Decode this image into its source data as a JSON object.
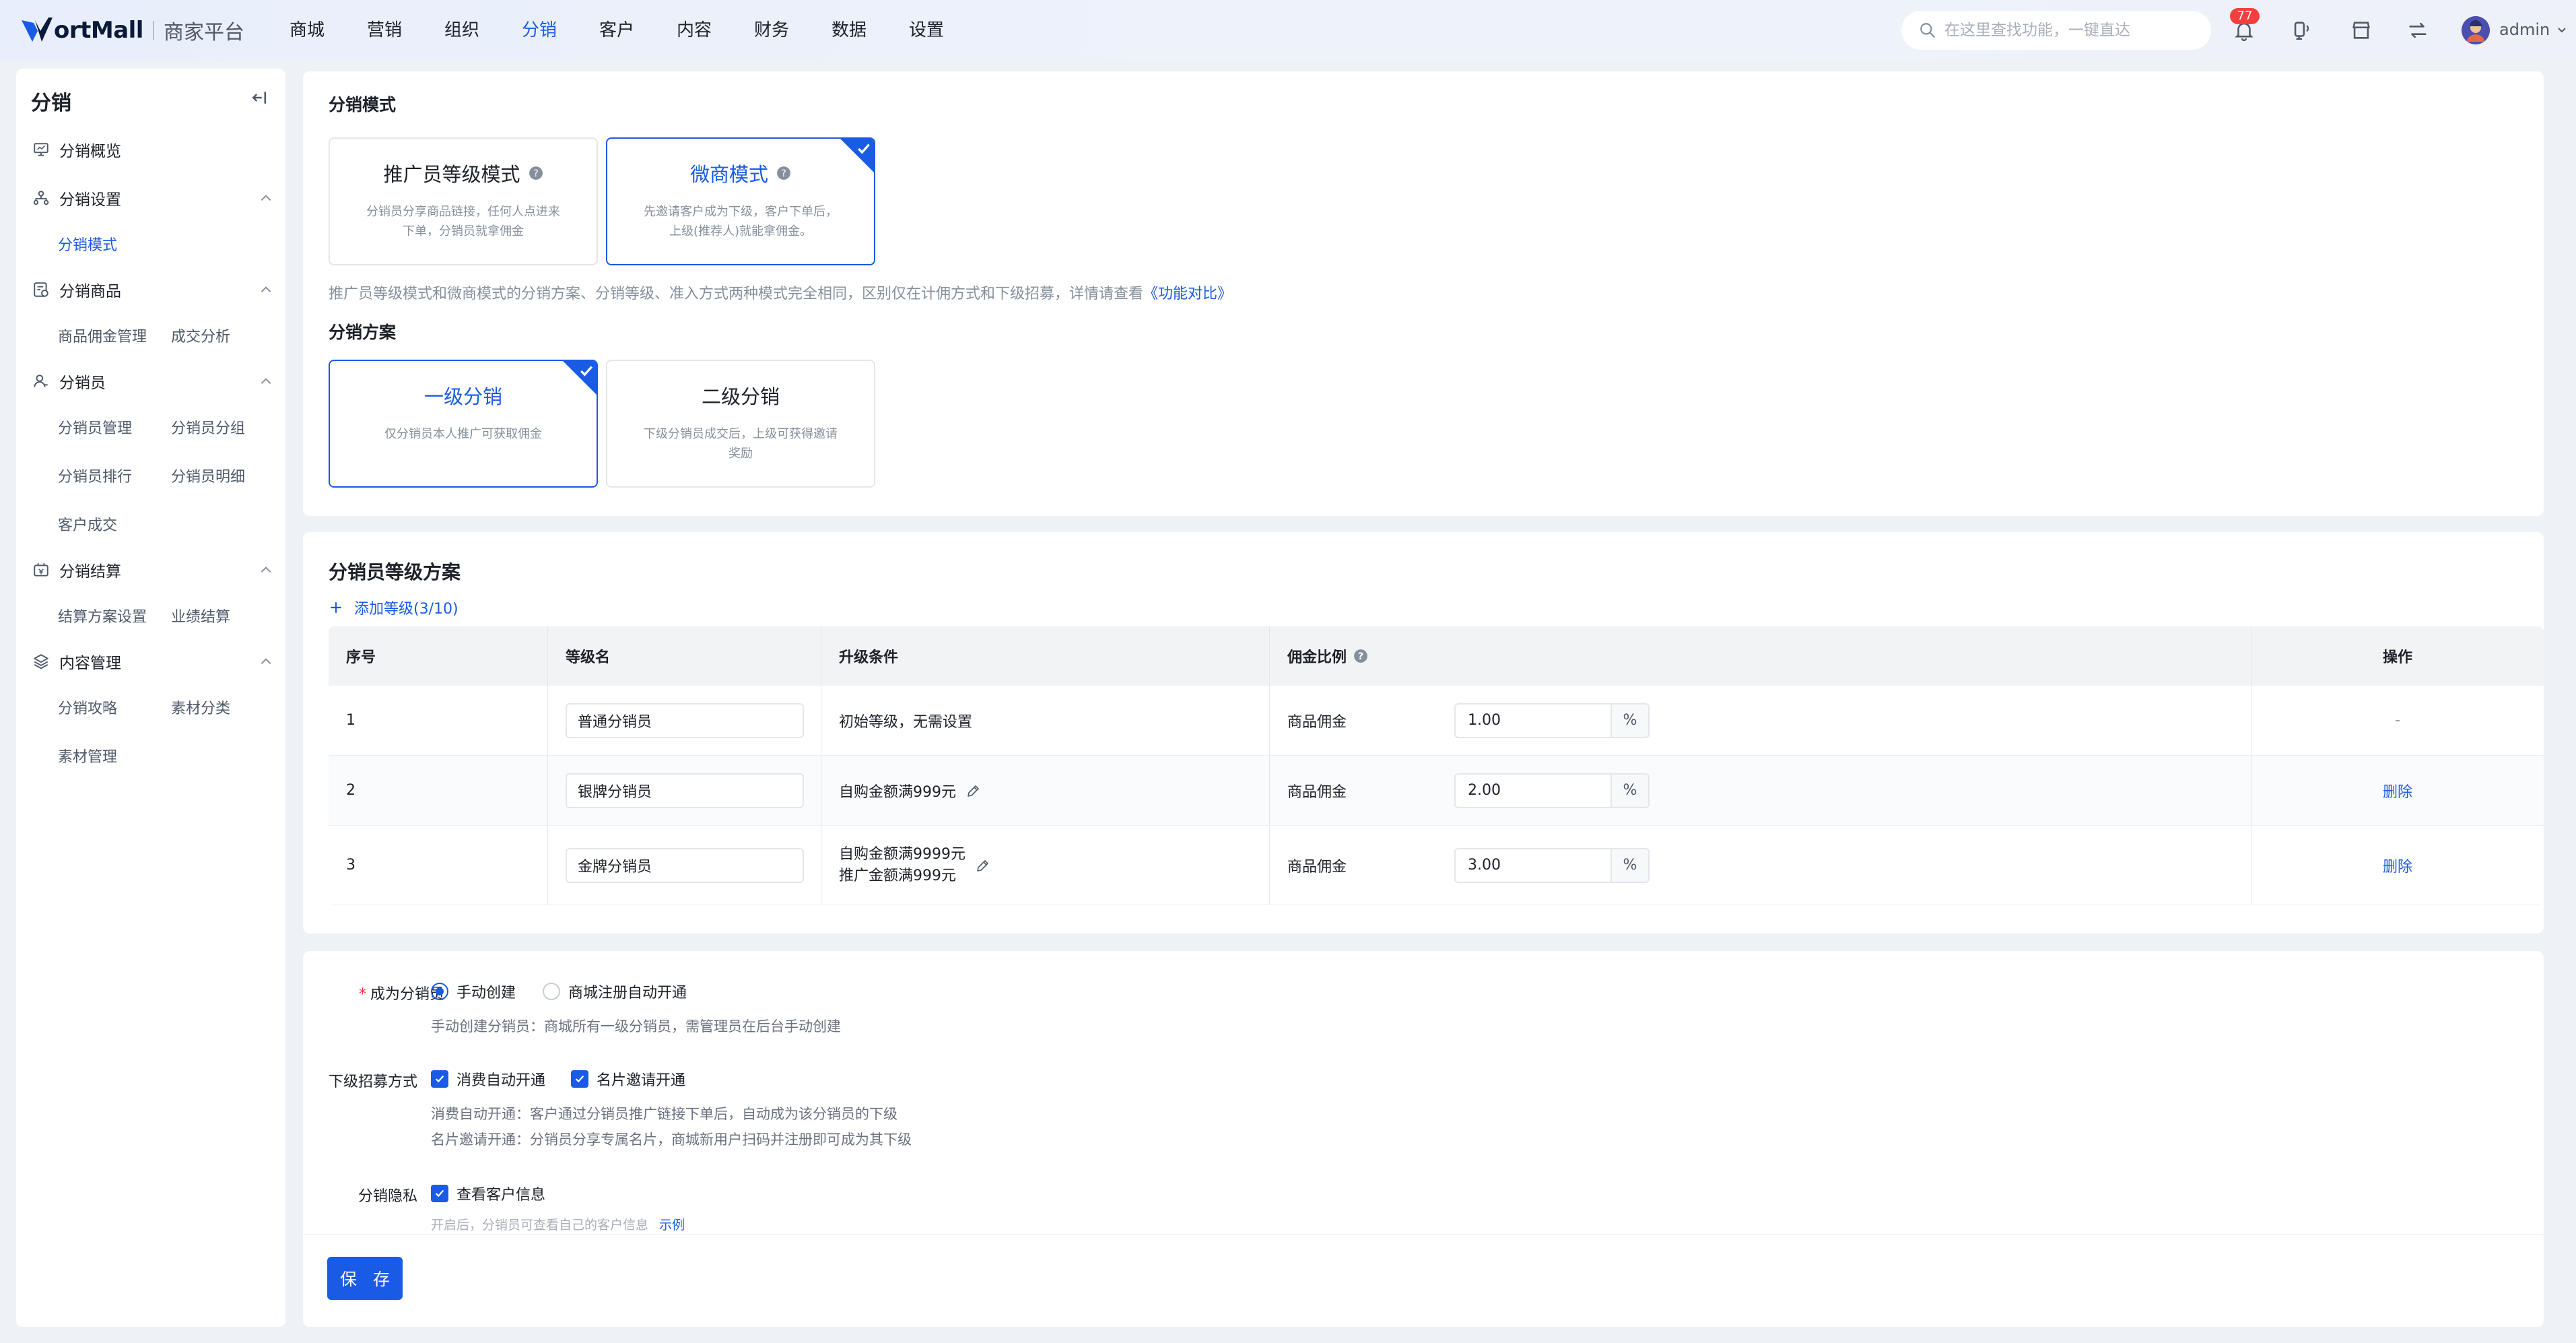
{
  "brand": {
    "logo_text": "ortMall",
    "subtitle": "商家平台"
  },
  "nav": {
    "items": [
      "商城",
      "营销",
      "组织",
      "分销",
      "客户",
      "内容",
      "财务",
      "数据",
      "设置"
    ],
    "active": "分销"
  },
  "search": {
    "placeholder": "在这里查找功能，一键直达"
  },
  "notifications": {
    "count": "77"
  },
  "user": {
    "name": "admin"
  },
  "sidebar": {
    "title": "分销",
    "groups": [
      {
        "label": "分销概览",
        "icon": "monitor-icon"
      },
      {
        "label": "分销设置",
        "icon": "org-icon",
        "links": [
          "分销模式"
        ]
      },
      {
        "label": "分销商品",
        "icon": "goods-icon",
        "links": [
          "商品佣金管理",
          "成交分析"
        ]
      },
      {
        "label": "分销员",
        "icon": "user-icon",
        "links": [
          "分销员管理",
          "分销员分组",
          "分销员排行",
          "分销员明细",
          "客户成交"
        ]
      },
      {
        "label": "分销结算",
        "icon": "settle-icon",
        "links": [
          "结算方案设置",
          "业绩结算"
        ]
      },
      {
        "label": "内容管理",
        "icon": "layers-icon",
        "links": [
          "分销攻略",
          "素材分类",
          "素材管理"
        ]
      }
    ],
    "active_link": "分销模式"
  },
  "mode_section": {
    "title": "分销模式",
    "options": [
      {
        "title": "推广员等级模式",
        "desc": "分销员分享商品链接，任何人点进来下单，分销员就拿佣金",
        "selected": false
      },
      {
        "title": "微商模式",
        "desc": "先邀请客户成为下级，客户下单后，上级(推荐人)就能拿佣金。",
        "selected": true
      }
    ],
    "hint_text": "推广员等级模式和微商模式的分销方案、分销等级、准入方式两种模式完全相同，区别仅在计佣方式和下级招募，详情请查看",
    "hint_link": "《功能对比》"
  },
  "plan_section": {
    "title": "分销方案",
    "options": [
      {
        "title": "一级分销",
        "desc": "仅分销员本人推广可获取佣金",
        "selected": true
      },
      {
        "title": "二级分销",
        "desc": "下级分销员成交后，上级可获得邀请奖励",
        "selected": false
      }
    ]
  },
  "level_section": {
    "title": "分销员等级方案",
    "add_label": "添加等级(3/10)",
    "columns": [
      "序号",
      "等级名",
      "升级条件",
      "佣金比例",
      "操作"
    ],
    "rows": [
      {
        "no": "1",
        "name": "普通分销员",
        "condition": [
          "初始等级，无需设置"
        ],
        "commission_label": "商品佣金",
        "rate": "1.00",
        "unit": "%",
        "action": "-"
      },
      {
        "no": "2",
        "name": "银牌分销员",
        "condition": [
          "自购金额满999元"
        ],
        "commission_label": "商品佣金",
        "rate": "2.00",
        "unit": "%",
        "action": "删除"
      },
      {
        "no": "3",
        "name": "金牌分销员",
        "condition": [
          "自购金额满9999元",
          "推广金额满999元"
        ],
        "commission_label": "商品佣金",
        "rate": "3.00",
        "unit": "%",
        "action": "删除"
      }
    ]
  },
  "form": {
    "become": {
      "label": "成为分销员",
      "options": [
        "手动创建",
        "商城注册自动开通"
      ],
      "selected": "手动创建",
      "hint": "手动创建分销员：商城所有一级分销员，需管理员在后台手动创建"
    },
    "recruit": {
      "label": "下级招募方式",
      "options": [
        "消费自动开通",
        "名片邀请开通"
      ],
      "hint1": "消费自动开通：客户通过分销员推广链接下单后，自动成为该分销员的下级",
      "hint2": "名片邀请开通：分销员分享专属名片，商城新用户扫码并注册即可成为其下级"
    },
    "privacy": {
      "label": "分销隐私",
      "option": "查看客户信息",
      "hint": "开启后，分销员可查看自己的客户信息",
      "hint_link": "示例"
    }
  },
  "save_label": "保 存",
  "colors": {
    "primary": "#1a5be6",
    "danger": "#f53f3f",
    "bg": "#eef1f6"
  }
}
